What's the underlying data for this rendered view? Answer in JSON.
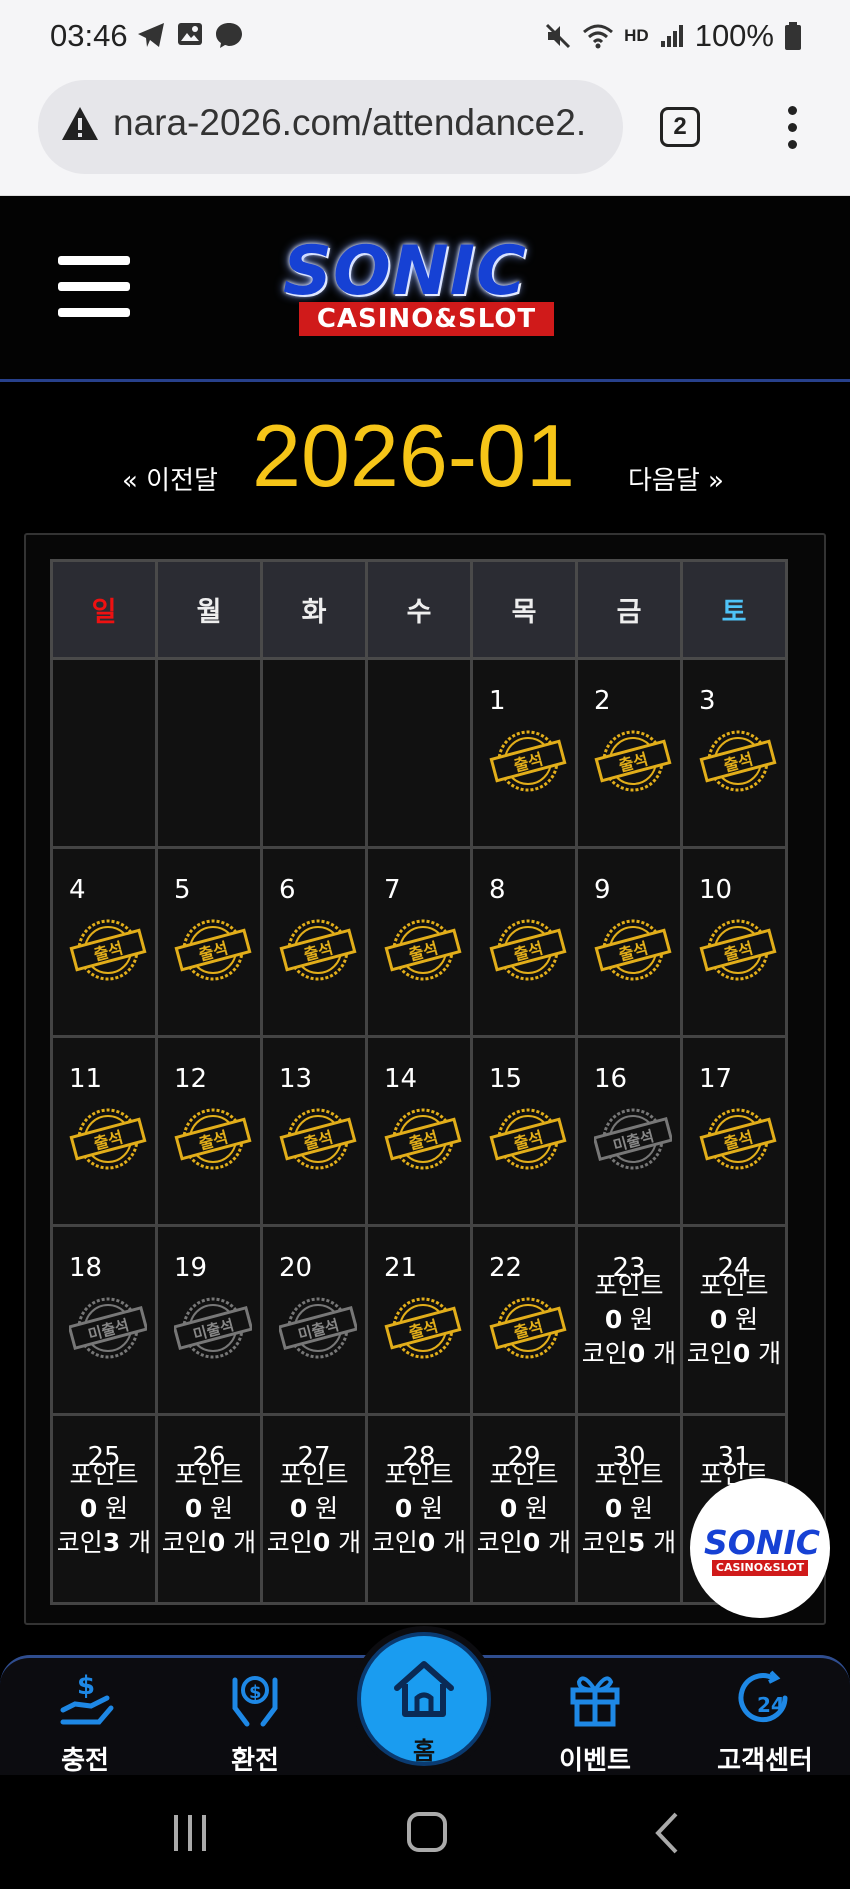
{
  "status_bar": {
    "time": "03:46",
    "battery": "100%",
    "hd_label": "HD"
  },
  "browser": {
    "url": "nara-2026.com/attendance2.",
    "tab_count": "2"
  },
  "logo": {
    "word": "SONIC",
    "tag": "CASINO&SLOT"
  },
  "month_nav": {
    "prev_label": "« 이전달",
    "title": "2026-01",
    "next_label": "다음달 »"
  },
  "weekdays": [
    "일",
    "월",
    "화",
    "수",
    "목",
    "금",
    "토"
  ],
  "stamp_labels": {
    "attended": "출석",
    "absent": "미출석"
  },
  "calendar": {
    "weeks": [
      [
        {},
        {},
        {},
        {},
        {
          "day": "1",
          "status": "attended"
        },
        {
          "day": "2",
          "status": "attended"
        },
        {
          "day": "3",
          "status": "attended"
        }
      ],
      [
        {
          "day": "4",
          "status": "attended"
        },
        {
          "day": "5",
          "status": "attended"
        },
        {
          "day": "6",
          "status": "attended"
        },
        {
          "day": "7",
          "status": "attended"
        },
        {
          "day": "8",
          "status": "attended"
        },
        {
          "day": "9",
          "status": "attended"
        },
        {
          "day": "10",
          "status": "attended"
        }
      ],
      [
        {
          "day": "11",
          "status": "attended"
        },
        {
          "day": "12",
          "status": "attended"
        },
        {
          "day": "13",
          "status": "attended"
        },
        {
          "day": "14",
          "status": "attended"
        },
        {
          "day": "15",
          "status": "attended"
        },
        {
          "day": "16",
          "status": "absent"
        },
        {
          "day": "17",
          "status": "attended"
        }
      ],
      [
        {
          "day": "18",
          "status": "absent"
        },
        {
          "day": "19",
          "status": "absent"
        },
        {
          "day": "20",
          "status": "absent"
        },
        {
          "day": "21",
          "status": "attended"
        },
        {
          "day": "22",
          "status": "attended"
        },
        {
          "day": "23",
          "status": "future",
          "point_label": "포인트",
          "point": "0",
          "point_unit": "원",
          "coin_label": "코인",
          "coin": "0",
          "coin_unit": "개"
        },
        {
          "day": "24",
          "status": "future",
          "point_label": "포인트",
          "point": "0",
          "point_unit": "원",
          "coin_label": "코인",
          "coin": "0",
          "coin_unit": "개"
        }
      ],
      [
        {
          "day": "25",
          "status": "future",
          "point_label": "포인트",
          "point": "0",
          "point_unit": "원",
          "coin_label": "코인",
          "coin": "3",
          "coin_unit": "개"
        },
        {
          "day": "26",
          "status": "future",
          "point_label": "포인트",
          "point": "0",
          "point_unit": "원",
          "coin_label": "코인",
          "coin": "0",
          "coin_unit": "개"
        },
        {
          "day": "27",
          "status": "future",
          "point_label": "포인트",
          "point": "0",
          "point_unit": "원",
          "coin_label": "코인",
          "coin": "0",
          "coin_unit": "개"
        },
        {
          "day": "28",
          "status": "future",
          "point_label": "포인트",
          "point": "0",
          "point_unit": "원",
          "coin_label": "코인",
          "coin": "0",
          "coin_unit": "개"
        },
        {
          "day": "29",
          "status": "future",
          "point_label": "포인트",
          "point": "0",
          "point_unit": "원",
          "coin_label": "코인",
          "coin": "0",
          "coin_unit": "개"
        },
        {
          "day": "30",
          "status": "future",
          "point_label": "포인트",
          "point": "0",
          "point_unit": "원",
          "coin_label": "코인",
          "coin": "5",
          "coin_unit": "개"
        },
        {
          "day": "31",
          "status": "future",
          "point_label": "포인트"
        }
      ]
    ]
  },
  "bottom_nav": {
    "deposit": "충전",
    "withdraw": "환전",
    "home": "홈",
    "event": "이벤트",
    "support": "고객센터",
    "support_badge": "24"
  },
  "colors": {
    "accent_gold": "#f6c518",
    "sunday": "#e11111",
    "saturday": "#4fc3f7",
    "home_blue": "#1a9cf0",
    "icon_blue": "#1e88e5"
  }
}
